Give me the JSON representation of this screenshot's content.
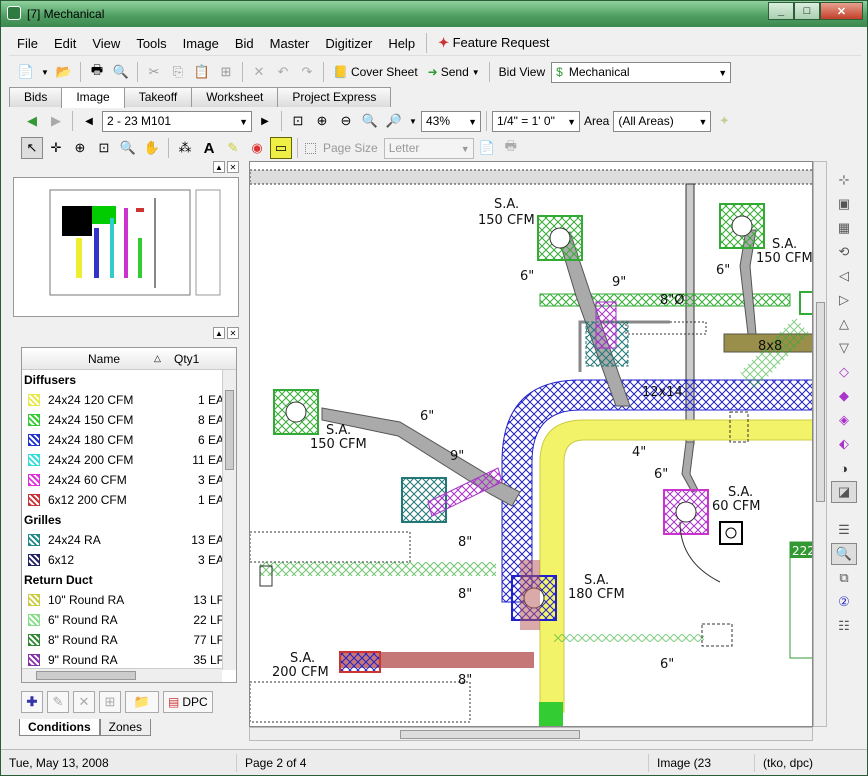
{
  "window": {
    "title": "[7] Mechanical"
  },
  "menu": [
    "File",
    "Edit",
    "View",
    "Tools",
    "Image",
    "Bid",
    "Master",
    "Digitizer",
    "Help",
    "Feature Request"
  ],
  "toolbar1": {
    "cover_sheet": "Cover Sheet",
    "send": "Send",
    "bid_view_label": "Bid View",
    "bid_view_value": "Mechanical"
  },
  "tabs": [
    "Bids",
    "Image",
    "Takeoff",
    "Worksheet",
    "Project Express"
  ],
  "toolbar2": {
    "page_value": "2 - 23 M101",
    "zoom_value": "43%",
    "scale_value": "1/4\" = 1' 0\"",
    "area_label": "Area",
    "area_value": "(All Areas)"
  },
  "toolbar3": {
    "page_size_label": "Page Size",
    "page_size_value": "Letter"
  },
  "list": {
    "col_name": "Name",
    "col_qty": "Qty1",
    "groups": [
      {
        "name": "Diffusers",
        "items": [
          {
            "name": "24x24 120 CFM",
            "qty": "1 EA",
            "color": "#e8e84a"
          },
          {
            "name": "24x24 150 CFM",
            "qty": "8 EA",
            "color": "#33cc33"
          },
          {
            "name": "24x24 180 CFM",
            "qty": "6 EA",
            "color": "#2233cc"
          },
          {
            "name": "24x24 200 CFM",
            "qty": "11 EA",
            "color": "#33dddd"
          },
          {
            "name": "24x24 60 CFM",
            "qty": "3 EA",
            "color": "#dd33dd"
          },
          {
            "name": "6x12 200 CFM",
            "qty": "1 EA",
            "color": "#cc3333"
          }
        ]
      },
      {
        "name": "Grilles",
        "items": [
          {
            "name": "24x24 RA",
            "qty": "13 EA",
            "color": "#228888"
          },
          {
            "name": "6x12",
            "qty": "3 EA",
            "color": "#222266"
          }
        ]
      },
      {
        "name": "Return Duct",
        "items": [
          {
            "name": "10\" Round RA",
            "qty": "13 LF",
            "color": "#cccc44"
          },
          {
            "name": "6\" Round RA",
            "qty": "22 LF",
            "color": "#88dd88"
          },
          {
            "name": "8\" Round RA",
            "qty": "77 LF",
            "color": "#338833"
          },
          {
            "name": "9\" Round RA",
            "qty": "35 LF",
            "color": "#8833aa"
          }
        ]
      }
    ]
  },
  "bottom_tabs": [
    "Conditions",
    "Zones"
  ],
  "dpc_label": "DPC",
  "drawing": {
    "labels": [
      "S.A.",
      "150 CFM",
      "S.A.",
      "150 CFM",
      "S.A.",
      "150 CFM",
      "S.A.",
      "60 CFM",
      "S.A.",
      "180 CFM",
      "S.A.",
      "200 CFM",
      "6\"",
      "9\"",
      "8\"Ø",
      "6\"",
      "8x8",
      "12x14",
      "6\"",
      "9\"",
      "4\"",
      "6\"",
      "8\"",
      "8\"",
      "6\"",
      "8\"",
      "222"
    ]
  },
  "status": {
    "date": "Tue, May 13, 2008",
    "page": "Page 2 of 4",
    "image": "Image (23",
    "user": "(tko, dpc)"
  }
}
